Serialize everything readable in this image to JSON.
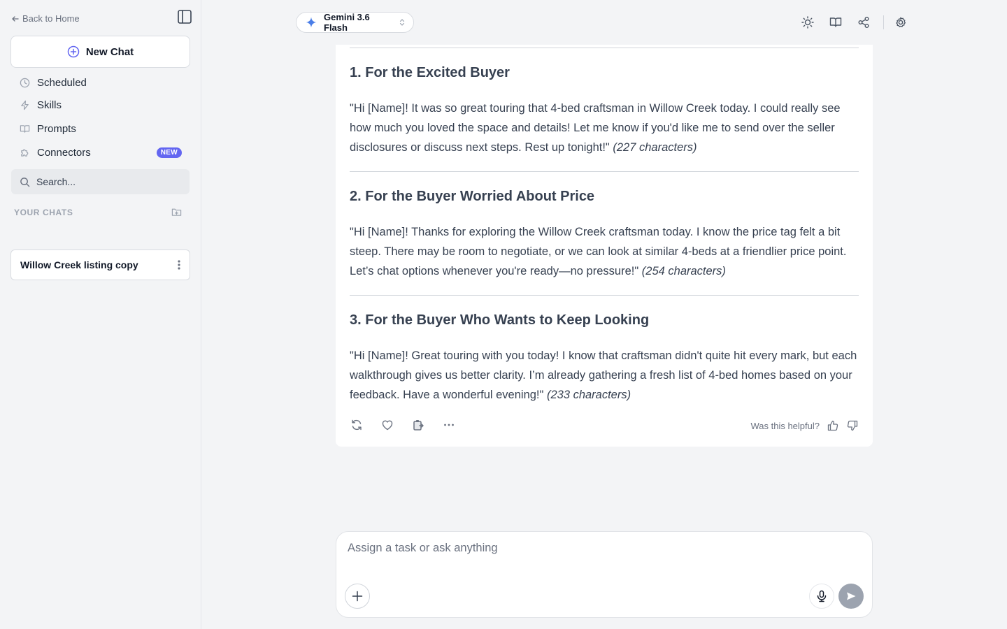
{
  "colors": {
    "accent": "#6366f1",
    "background": "#f3f4f6",
    "card": "#ffffff",
    "send_button": "#9ca3af"
  },
  "sidebar": {
    "back_label": "Back to Home",
    "new_chat_label": "New Chat",
    "items": [
      {
        "label": "Scheduled",
        "icon": "clock-icon"
      },
      {
        "label": "Skills",
        "icon": "bolt-icon"
      },
      {
        "label": "Prompts",
        "icon": "book-icon"
      },
      {
        "label": "Connectors",
        "icon": "puzzle-icon",
        "badge": "NEW"
      }
    ],
    "search_placeholder": "Search...",
    "chats_header": "YOUR CHATS",
    "chats": [
      {
        "title": "Willow Creek listing copy"
      }
    ]
  },
  "header": {
    "model_name": "Gemini 3.6 Flash",
    "icons": [
      "sun-icon",
      "book-icon",
      "share-icon",
      "settings-icon"
    ]
  },
  "message": {
    "sections": [
      {
        "title": "1. For the Excited Buyer",
        "text": "\"Hi [Name]! It was so great touring that 4-bed craftsman in Willow Creek today. I could really see how much you loved the space and details! Let me know if you'd like me to send over the seller disclosures or discuss next steps. Rest up tonight!\"",
        "note": "(227 characters)"
      },
      {
        "title": "2. For the Buyer Worried About Price",
        "text": "\"Hi [Name]! Thanks for exploring the Willow Creek craftsman today. I know the price tag felt a bit steep. There may be room to negotiate, or we can look at similar 4-beds at a friendlier price point. Let’s chat options whenever you're ready—no pressure!\"",
        "note": "(254 characters)"
      },
      {
        "title": "3. For the Buyer Who Wants to Keep Looking",
        "text": "\"Hi [Name]! Great touring with you today! I know that craftsman didn't quite hit every mark, but each walkthrough gives us better clarity. I’m already gathering a fresh list of 4-bed homes based on your feedback. Have a wonderful evening!\"",
        "note": "(233 characters)"
      }
    ],
    "helpful_label": "Was this helpful?"
  },
  "composer": {
    "placeholder": "Assign a task or ask anything"
  }
}
